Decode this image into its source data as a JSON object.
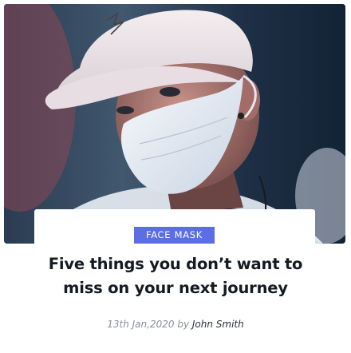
{
  "card": {
    "image_description_icon": "photo-person-face-mask",
    "category_label": "FACE MASK",
    "title": "Five things you don’t want to miss on your next journey",
    "date": "13th Jan,2020",
    "by": "by",
    "author": "John Smith"
  },
  "colors": {
    "accent": "#5b6ee6",
    "title": "#141a22",
    "meta": "#8a8f9a",
    "author": "#2a2f39"
  }
}
